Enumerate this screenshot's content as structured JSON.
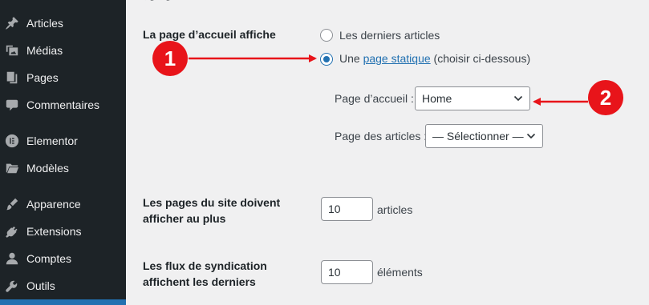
{
  "sidebar": {
    "items": [
      {
        "label": "Articles",
        "icon": "pin-icon"
      },
      {
        "label": "Médias",
        "icon": "media-icon"
      },
      {
        "label": "Pages",
        "icon": "pages-icon"
      },
      {
        "label": "Commentaires",
        "icon": "comment-icon"
      },
      {
        "label": "Elementor",
        "icon": "elementor-icon"
      },
      {
        "label": "Modèles",
        "icon": "folder-icon"
      },
      {
        "label": "Apparence",
        "icon": "brush-icon"
      },
      {
        "label": "Extensions",
        "icon": "plugin-icon"
      },
      {
        "label": "Comptes",
        "icon": "user-icon"
      },
      {
        "label": "Outils",
        "icon": "wrench-icon"
      }
    ]
  },
  "settings": {
    "homepage_label": "La page d’accueil affiche",
    "option_latest": "Les derniers articles",
    "option_static_prefix": "Une",
    "option_static_link": "page statique",
    "option_static_suffix": "(choisir ci-dessous)",
    "front_page_label": "Page d’accueil :",
    "front_page_value": "Home",
    "posts_page_label": "Page des articles :",
    "posts_page_value": "— Sélectionner —",
    "per_page_label_1": "Les pages du site doivent",
    "per_page_label_2": "afficher au plus",
    "per_page_value": "10",
    "per_page_unit": "articles",
    "feed_label_1": "Les flux de syndication",
    "feed_label_2": "affichent les derniers",
    "feed_value": "10",
    "feed_unit": "éléments"
  },
  "annotations": {
    "badge_1": "1",
    "badge_2": "2"
  },
  "colors": {
    "sidebar_bg": "#1d2327",
    "accent": "#2271b1",
    "annotation_red": "#e8141a"
  }
}
